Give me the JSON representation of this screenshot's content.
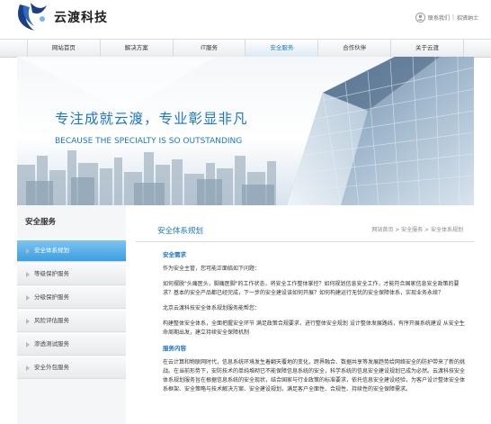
{
  "header": {
    "logo_text": "云渡科技",
    "links": [
      "联系我们",
      "招贤纳士"
    ],
    "link_separator": "|"
  },
  "nav": {
    "items": [
      "网站首页",
      "解决方案",
      "IT服务",
      "安全服务",
      "合作伙伴",
      "关于云渡"
    ],
    "active_index": 3
  },
  "banner": {
    "title": "专注成就云渡，专业彰显非凡",
    "subtitle": "BECAUSE THE SPECIALTY IS SO OUTSTANDING"
  },
  "sidebar": {
    "title": "安全服务",
    "items": [
      "安全体系规划",
      "等级保护服务",
      "分级保护服务",
      "风险评估服务",
      "渗透测试服务",
      "安全外包服务"
    ],
    "active_index": 0
  },
  "main": {
    "title": "安全体系规划",
    "breadcrumb": "网站首页 > 安全服务 > 安全体系规划",
    "section1_title": "安全需求",
    "p1": "作为安全主管，您可能正面临如下问题：",
    "p2": "如何摆脱\"头痛医头，脚痛医脚\"的工作状态，将安全工作整体掌控？如何规划信息安全工作，才能符合国家信息安全政策的要求？基本的安全产品都已经完成，下一步的安全建设该如何开展？如何构建运行无忧的安全保障体系，实现业务永续？",
    "p3": "北京云渡科技安全体系规划服务能帮您：",
    "p4": "构建整体安全体系，全面把握安全环节 满足政策合规要求，进行整体安全规划 设计整体发展路线，有序开展系统建设 从安全生命周期出发，建立持续安全保障机制",
    "section2_title": "服务内容",
    "p5": "在云计算和物联网时代，信息系统环境发生着翻天覆地的变化，跨界融合、数据共享等发展趋势给网络安全的防护带来了新的挑战。在当前形势下，安防技术的单纯堆砌已不能保障信息系统的安全，科学系统的信息安全建设规划已成为必然。云渡科技安全体系规划服务旨在根据信息系统的安全现状，结合国家与行业政策的标准要求，依托信息安全建设经验，为客户设计整体安全体系框架、安全策略与技术解决方案、安全建设规划，满足客户全面性、合规性、持续性的安全保障需求。"
  },
  "colors": {
    "accent": "#1e76c8",
    "sidebar_active": "#4aa8e6",
    "nav_bg": "#eef1f4"
  }
}
